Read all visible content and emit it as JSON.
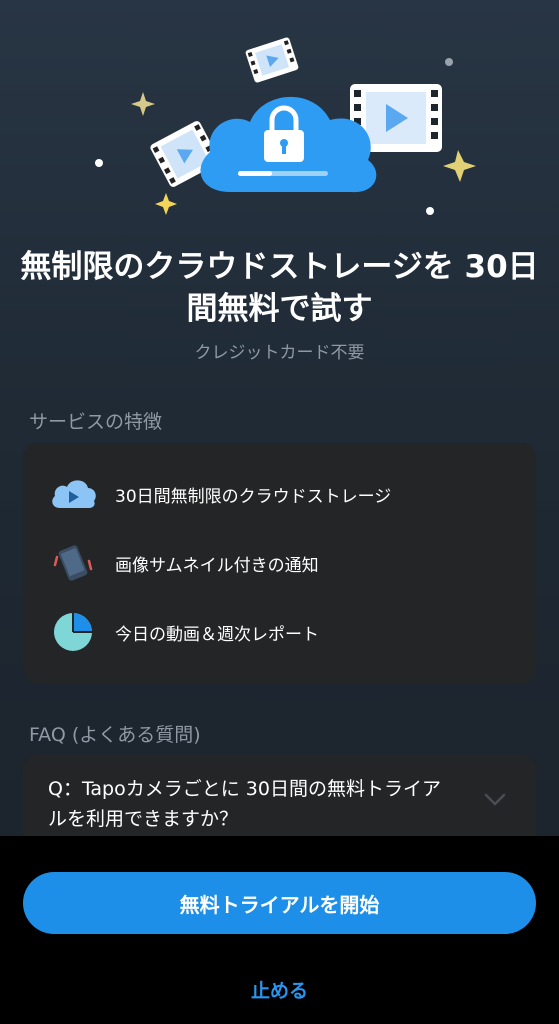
{
  "hero": {
    "title": "無制限のクラウドストレージを 30日間無料で試す",
    "subtitle": "クレジットカード不要"
  },
  "features_section": {
    "label": "サービスの特徴",
    "items": [
      {
        "icon": "cloud-play-icon",
        "text": "30日間無制限のクラウドストレージ"
      },
      {
        "icon": "phone-notification-icon",
        "text": "画像サムネイル付きの通知"
      },
      {
        "icon": "pie-chart-icon",
        "text": "今日の動画＆週次レポート"
      }
    ]
  },
  "faq_section": {
    "label": "FAQ (よくある質問)",
    "items": [
      {
        "question": "Q：Tapoカメラごとに 30日間の無料トライアルを利用できますか？"
      }
    ]
  },
  "actions": {
    "start_trial": "無料トライアルを開始",
    "stop": "止める"
  },
  "colors": {
    "accent": "#1d8fe8",
    "link": "#2a95ee",
    "card": "#232527",
    "cloud": "#2e9cf2"
  }
}
